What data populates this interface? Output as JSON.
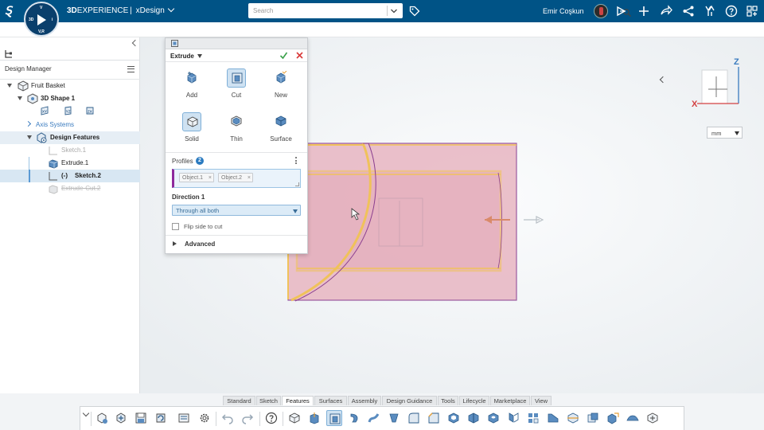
{
  "app": {
    "brand_bold": "3D",
    "brand_rest": "EXPERIENCE",
    "separator": "|",
    "app_name": "xDesign",
    "compass": {
      "top": "V",
      "left": "3D",
      "right": "i",
      "bottom": "V,R"
    }
  },
  "search": {
    "placeholder": "Search"
  },
  "user": {
    "name": "Emir Coşkun"
  },
  "topbar_icons": [
    "tag-icon",
    "share-icon",
    "add-icon",
    "forward-icon",
    "network-icon",
    "community-icon",
    "help-icon",
    "apps-grid-icon"
  ],
  "design_manager": {
    "title": "Design Manager",
    "tree": [
      {
        "label": "Fruit Basket",
        "icon": "product-icon",
        "state": "normal"
      },
      {
        "label": "3D Shape 1",
        "icon": "part-icon",
        "state": "bold"
      },
      {
        "label": "Axis Systems",
        "icon": "",
        "state": "link"
      },
      {
        "label": "Design Features",
        "icon": "features-icon",
        "state": "bold"
      },
      {
        "label": "Sketch.1",
        "icon": "sketch-icon",
        "state": "dim"
      },
      {
        "label": "Extrude.1",
        "icon": "extrude-icon",
        "state": "normal"
      },
      {
        "label": "(-)",
        "icon": "sketch-icon",
        "state": "bold"
      },
      {
        "label": "Sketch.2",
        "icon": "",
        "state": "bold"
      },
      {
        "label": "Extrude-Cut.2",
        "icon": "extrude-cut-icon",
        "state": "strike"
      }
    ],
    "plane_labels": [
      "XY",
      "YZ",
      "ZX"
    ]
  },
  "extrude_dialog": {
    "title": "Extrude",
    "operations": [
      {
        "label": "Add",
        "icon": "add-solid-icon",
        "active": false
      },
      {
        "label": "Cut",
        "icon": "cut-solid-icon",
        "active": true
      },
      {
        "label": "New",
        "icon": "new-body-icon",
        "active": false
      }
    ],
    "body_types": [
      {
        "label": "Solid",
        "icon": "solid-icon",
        "active": true
      },
      {
        "label": "Thin",
        "icon": "thin-icon",
        "active": false
      },
      {
        "label": "Surface",
        "icon": "surface-icon",
        "active": false
      }
    ],
    "profiles_label": "Profiles",
    "profiles_count": "2",
    "profiles": [
      "Object.1",
      "Object.2"
    ],
    "direction_label": "Direction 1",
    "direction_value": "Through all both",
    "flip_label": "Flip side to cut",
    "advanced_label": "Advanced"
  },
  "viewport": {
    "units": "mm",
    "axis_labels": {
      "z": "Z",
      "x": "X"
    },
    "colors": {
      "body_fill": "#e8b6c2",
      "body_edge": "#f0c25a",
      "preview_outline": "#8b3f8f",
      "arrow": "#d98a6a"
    }
  },
  "bottom_tabs": [
    {
      "label": "Standard",
      "active": false
    },
    {
      "label": "Sketch",
      "active": false
    },
    {
      "label": "Features",
      "active": true
    },
    {
      "label": "Surfaces",
      "active": false
    },
    {
      "label": "Assembly",
      "active": false
    },
    {
      "label": "Design Guidance",
      "active": false
    },
    {
      "label": "Tools",
      "active": false
    },
    {
      "label": "Lifecycle",
      "active": false
    },
    {
      "label": "Marketplace",
      "active": false
    },
    {
      "label": "View",
      "active": false
    }
  ]
}
